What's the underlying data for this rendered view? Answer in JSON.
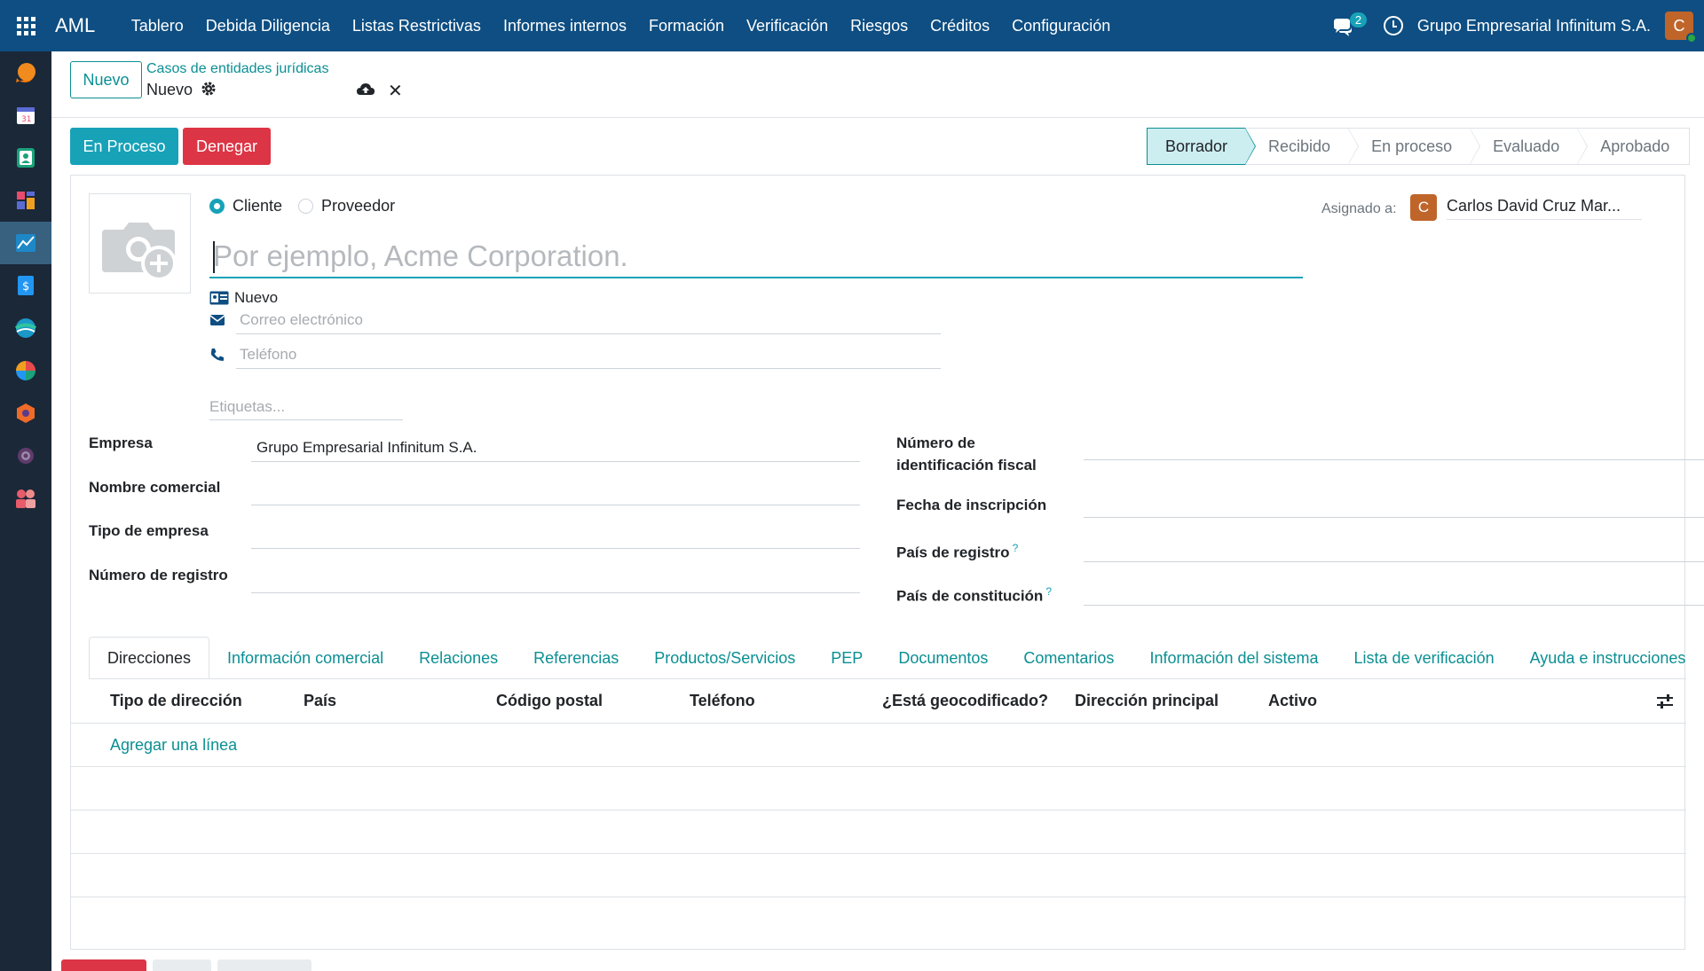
{
  "app": {
    "brand": "AML"
  },
  "menu": [
    "Tablero",
    "Debida Diligencia",
    "Listas Restrictivas",
    "Informes internos",
    "Formación",
    "Verificación",
    "Riesgos",
    "Créditos",
    "Configuración"
  ],
  "topbar": {
    "messages_count": "2",
    "company": "Grupo Empresarial Infinitum S.A.",
    "user_initial": "C"
  },
  "sidebar_icons": [
    {
      "name": "discuss-icon",
      "color": "#f0780a"
    },
    {
      "name": "calendar-icon",
      "color": "#5b6bd4"
    },
    {
      "name": "contacts-icon",
      "color": "#1aa37a"
    },
    {
      "name": "dashboard-icon",
      "color": "#e84b6c"
    },
    {
      "name": "aml-icon",
      "color": "#1e88c7",
      "active": true
    },
    {
      "name": "invoicing-icon",
      "color": "#2196f3"
    },
    {
      "name": "sales-icon",
      "color": "#1b98c7"
    },
    {
      "name": "reports-icon",
      "color": "#e84b4b"
    },
    {
      "name": "apps-icon",
      "color": "#f06b28"
    },
    {
      "name": "settings-icon",
      "color": "#5f6b7a"
    },
    {
      "name": "employees-icon",
      "color": "#e85b6b"
    }
  ],
  "control_panel": {
    "new_button": "Nuevo",
    "breadcrumb": "Casos de entidades jurídicas",
    "record_name": "Nuevo"
  },
  "status_buttons": {
    "process": "En Proceso",
    "deny": "Denegar"
  },
  "stages": [
    {
      "label": "Borrador",
      "current": true
    },
    {
      "label": "Recibido",
      "current": false
    },
    {
      "label": "En proceso",
      "current": false
    },
    {
      "label": "Evaluado",
      "current": false
    },
    {
      "label": "Aprobado",
      "current": false
    }
  ],
  "form": {
    "type_options": [
      "Cliente",
      "Proveedor"
    ],
    "type_selected": "Cliente",
    "assigned_label": "Asignado a:",
    "assigned_initial": "C",
    "assigned_value": "Carlos David Cruz Mar...",
    "name_placeholder": "Por ejemplo, Acme Corporation.",
    "stage_text": "Nuevo",
    "email_placeholder": "Correo electrónico",
    "phone_placeholder": "Teléfono",
    "tags_placeholder": "Etiquetas...",
    "left_fields": [
      {
        "label": "Empresa",
        "value": "Grupo Empresarial Infinitum S.A."
      },
      {
        "label": "Nombre comercial",
        "value": ""
      },
      {
        "label": "Tipo de empresa",
        "value": ""
      },
      {
        "label": "Número de registro",
        "value": ""
      }
    ],
    "right_fields": [
      {
        "label_line1": "Número de",
        "label_line2": "identificación fiscal",
        "value": ""
      },
      {
        "label": "Fecha de inscripción",
        "value": ""
      },
      {
        "label": "País de registro",
        "help": "?",
        "value": ""
      },
      {
        "label": "País de constitución",
        "help": "?",
        "value": ""
      }
    ]
  },
  "tabs": [
    "Direcciones",
    "Información comercial",
    "Relaciones",
    "Referencias",
    "Productos/Servicios",
    "PEP",
    "Documentos",
    "Comentarios",
    "Información del sistema",
    "Lista de verificación",
    "Ayuda e instrucciones"
  ],
  "table": {
    "columns": [
      "Tipo de dirección",
      "País",
      "Código postal",
      "Teléfono",
      "¿Está geocodificado?",
      "Dirección principal",
      "Activo"
    ],
    "add_line": "Agregar una línea"
  },
  "colors": {
    "navbar": "#0e4e82",
    "sidebar": "#1b2838",
    "primary": "#17a2b8",
    "danger": "#dc3545",
    "link": "#0b8f93"
  }
}
